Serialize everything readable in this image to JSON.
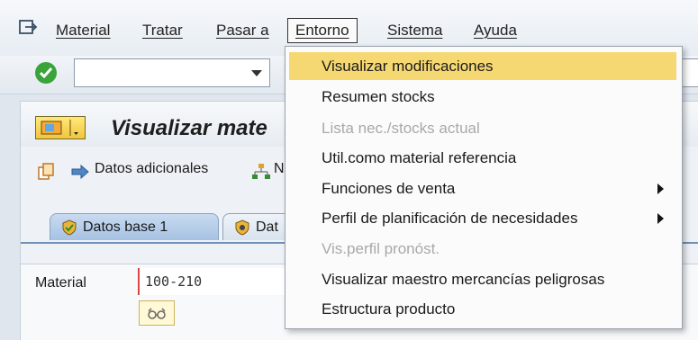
{
  "menubar": {
    "items": [
      "Material",
      "Tratar",
      "Pasar a",
      "Entorno",
      "Sistema",
      "Ayuda"
    ]
  },
  "title": {
    "text": "Visualizar mate"
  },
  "app_toolbar": {
    "datos_adicionales": "Datos adicionales",
    "truncated_button": "N"
  },
  "tabs": [
    "Datos base 1",
    "Dat"
  ],
  "field": {
    "label": "Material",
    "value": "100-210"
  },
  "dropdown": {
    "items": [
      {
        "label": "Visualizar modificaciones",
        "state": "highlight"
      },
      {
        "label": "Resumen stocks",
        "state": "normal"
      },
      {
        "label": "Lista nec./stocks actual",
        "state": "disabled"
      },
      {
        "label": "Util.como material referencia",
        "state": "normal"
      },
      {
        "label": "Funciones de venta",
        "state": "submenu"
      },
      {
        "label": "Perfil de planificación de necesidades",
        "state": "submenu"
      },
      {
        "label": "Vis.perfil pronóst.",
        "state": "disabled"
      },
      {
        "label": "Visualizar maestro mercancías peligrosas",
        "state": "normal"
      },
      {
        "label": "Estructura producto",
        "state": "normal"
      }
    ]
  },
  "colors": {
    "highlight": "#f6d872",
    "disabled_text": "#a9a9a9",
    "tab_active": "#a6c2e3"
  }
}
